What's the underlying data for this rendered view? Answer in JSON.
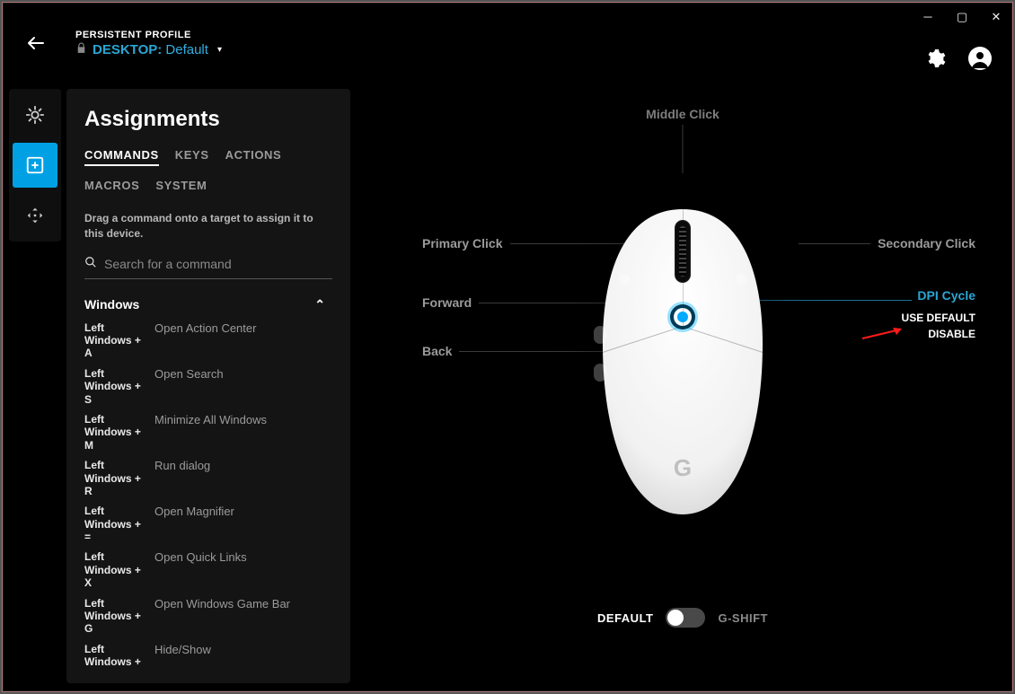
{
  "header": {
    "caption": "PERSISTENT PROFILE",
    "profile_label": "DESKTOP:",
    "profile_value": "Default"
  },
  "sidebar": {
    "title": "Assignments",
    "tabs": [
      "COMMANDS",
      "KEYS",
      "ACTIONS",
      "MACROS",
      "SYSTEM"
    ],
    "active_tab": 0,
    "hint": "Drag a command onto a target to assign it to this device.",
    "search_placeholder": "Search for a command",
    "group": {
      "name": "Windows",
      "commands": [
        {
          "key": "Left Windows + A",
          "desc": "Open Action Center"
        },
        {
          "key": "Left Windows + S",
          "desc": "Open Search"
        },
        {
          "key": "Left Windows + M",
          "desc": "Minimize All Windows"
        },
        {
          "key": "Left Windows + R",
          "desc": "Run dialog"
        },
        {
          "key": "Left Windows + =",
          "desc": "Open Magnifier"
        },
        {
          "key": "Left Windows + X",
          "desc": "Open Quick Links"
        },
        {
          "key": "Left Windows + G",
          "desc": "Open Windows Game Bar"
        },
        {
          "key": "Left Windows +",
          "desc": "Hide/Show"
        }
      ]
    }
  },
  "mouse": {
    "labels": {
      "middle": "Middle Click",
      "primary": "Primary Click",
      "secondary": "Secondary Click",
      "forward": "Forward",
      "back": "Back",
      "dpi": "DPI Cycle"
    },
    "dpi_menu": {
      "use_default": "USE DEFAULT",
      "disable": "DISABLE"
    },
    "mode": {
      "default": "DEFAULT",
      "gshift": "G-SHIFT",
      "active": "default"
    }
  }
}
